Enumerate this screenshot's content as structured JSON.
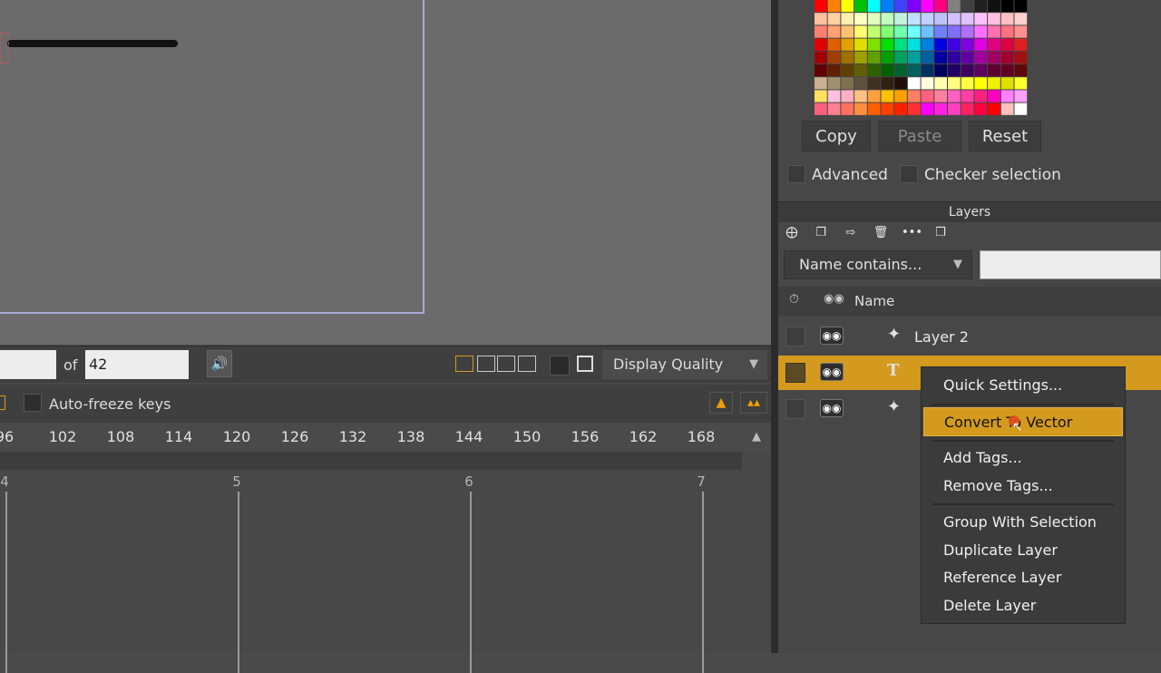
{
  "frame_bar": {
    "frame_value": "",
    "of_label": "of",
    "total_frames": "42",
    "display_quality": "Display Quality"
  },
  "timeline": {
    "auto_freeze_label": "Auto-freeze keys",
    "ruler_ticks": [
      "96",
      "102",
      "108",
      "114",
      "120",
      "126",
      "132",
      "138",
      "144",
      "150",
      "156",
      "162",
      "168"
    ],
    "second_labels": [
      "4",
      "5",
      "6",
      "7"
    ]
  },
  "palette": {
    "colors": [
      [
        "#ff0000",
        "#ff8000",
        "#ffff00",
        "#00c000",
        "#00ffff",
        "#0080ff",
        "#4040ff",
        "#8000ff",
        "#ff00ff",
        "#ff0080",
        "#808080",
        "#404040",
        "#202020",
        "#101010",
        "#000000",
        "#000000"
      ],
      [
        "#ffc0a0",
        "#ffd0a0",
        "#fff0b0",
        "#ffffc0",
        "#e0ffc0",
        "#c0ffc0",
        "#c0f0e0",
        "#c0e0ff",
        "#c0d0ff",
        "#c0c0ff",
        "#d0c0ff",
        "#e0c0ff",
        "#ffc0ff",
        "#ffc0e0",
        "#ffc0c0",
        "#ffd0d0"
      ],
      [
        "#ff8070",
        "#ffa070",
        "#ffc070",
        "#ffff70",
        "#c0ff70",
        "#80ff70",
        "#70ffb0",
        "#70ffff",
        "#70c0ff",
        "#7080ff",
        "#8070ff",
        "#b070ff",
        "#ff70ff",
        "#ff70b0",
        "#ff7080",
        "#ff9090"
      ],
      [
        "#e00000",
        "#e06000",
        "#e0a000",
        "#e0e000",
        "#80e000",
        "#00e000",
        "#00e080",
        "#00e0e0",
        "#0080e0",
        "#0000e0",
        "#4000e0",
        "#8000e0",
        "#e000e0",
        "#e00080",
        "#e00040",
        "#e02020"
      ],
      [
        "#a00000",
        "#a04000",
        "#a07000",
        "#a0a000",
        "#60a000",
        "#00a000",
        "#00a060",
        "#00a0a0",
        "#0060a0",
        "#0000a0",
        "#3000a0",
        "#6000a0",
        "#a000a0",
        "#a00060",
        "#a00030",
        "#a01010"
      ],
      [
        "#600000",
        "#602000",
        "#604000",
        "#606000",
        "#306000",
        "#006000",
        "#006030",
        "#006060",
        "#003060",
        "#000060",
        "#200060",
        "#400060",
        "#600060",
        "#600030",
        "#600020",
        "#600808"
      ],
      [
        "#c8b090",
        "#a09070",
        "#807050",
        "#605040",
        "#403020",
        "#302010",
        "#201008",
        "#ffffff",
        "#ffffe0",
        "#ffffb0",
        "#ffff80",
        "#ffff40",
        "#ffff00",
        "#f0f000",
        "#e0e000",
        "#ffff30"
      ],
      [
        "#ffe060",
        "#ffc0e0",
        "#ffb0c0",
        "#ffc080",
        "#ffa040",
        "#ffc000",
        "#ffa000",
        "#ff8060",
        "#ff6080",
        "#ff80a0",
        "#ff60c0",
        "#ff40a0",
        "#ff2080",
        "#ff00c0",
        "#ff80ff",
        "#ffa0ff"
      ],
      [
        "#ff6080",
        "#ff8090",
        "#ff7060",
        "#ff9040",
        "#ff6000",
        "#ff4000",
        "#ff2000",
        "#ff3030",
        "#ff00ff",
        "#ff20e0",
        "#ff40c0",
        "#ff2060",
        "#ff0040",
        "#ff0000",
        "#ffc0c0",
        "#ffffff"
      ]
    ]
  },
  "color_panel": {
    "copy": "Copy",
    "paste": "Paste",
    "reset": "Reset",
    "advanced": "Advanced",
    "checker": "Checker selection"
  },
  "layers": {
    "title": "Layers",
    "name_filter": "Name contains...",
    "name_column": "Name",
    "rows": [
      {
        "name": "Layer 2",
        "icon": "brush-icon"
      },
      {
        "name": "",
        "icon": "text-icon"
      },
      {
        "name": "",
        "icon": "brush-icon"
      }
    ]
  },
  "context_menu": {
    "items": [
      "Quick Settings...",
      "Convert To Vector",
      "Add Tags...",
      "Remove Tags...",
      "Group With Selection",
      "Duplicate Layer",
      "Reference Layer",
      "Delete Layer"
    ]
  },
  "colors": {
    "accent": "#d49a1d",
    "canvas_bg": "#6b6b6b"
  }
}
